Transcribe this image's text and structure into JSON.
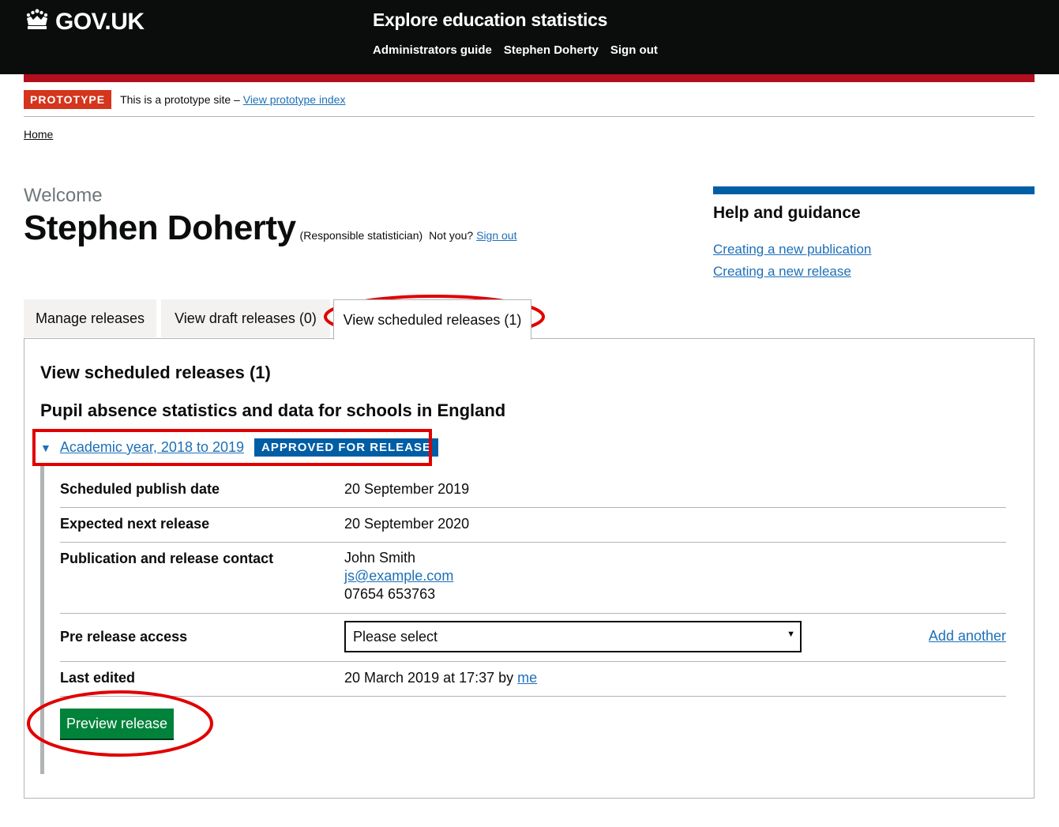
{
  "header": {
    "logo_text": "GOV.UK",
    "service_name": "Explore education statistics",
    "nav": [
      "Administrators guide",
      "Stephen Doherty",
      "Sign out"
    ]
  },
  "phase": {
    "tag": "PROTOTYPE",
    "text": "This is a prototype site –",
    "link": "View prototype index"
  },
  "breadcrumb": {
    "home": "Home"
  },
  "welcome": {
    "label": "Welcome",
    "name": "Stephen Doherty",
    "role": "(Responsible statistician)",
    "not_you": "Not you?",
    "sign_out": "Sign out"
  },
  "help": {
    "title": "Help and guidance",
    "links": [
      "Creating a new publication",
      "Creating a new release"
    ]
  },
  "tabs": [
    "Manage releases",
    "View draft releases (0)",
    "View scheduled releases (1)"
  ],
  "panel": {
    "title": "View scheduled releases (1)",
    "publication": "Pupil absence statistics and data for schools in England",
    "release_link": "Academic year, 2018 to 2019",
    "status": "APPROVED FOR RELEASE",
    "rows": {
      "publish_label": "Scheduled publish date",
      "publish_value": "20 September 2019",
      "next_label": "Expected next release",
      "next_value": "20 September 2020",
      "contact_label": "Publication and release contact",
      "contact_name": "John Smith",
      "contact_email": "js@example.com",
      "contact_phone": "07654 653763",
      "prerelease_label": "Pre release access",
      "prerelease_select": "Please select",
      "add_another": "Add another",
      "edited_label": "Last edited",
      "edited_value": "20 March 2019 at 17:37 by",
      "edited_by": "me"
    },
    "preview_button": "Preview release"
  },
  "colors": {
    "header_bg": "#0b0c0c",
    "prototype_red": "#d4351c",
    "approved_blue": "#005ea5",
    "preview_green": "#00823b",
    "annotation_red": "#e00000"
  }
}
